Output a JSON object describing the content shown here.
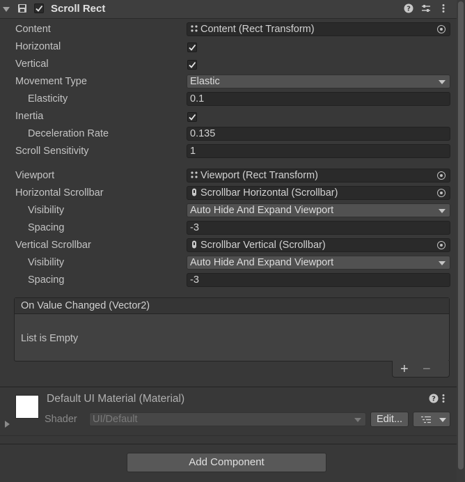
{
  "component": {
    "title": "Scroll Rect",
    "enabled": true
  },
  "properties": {
    "content": {
      "label": "Content",
      "value": "Content (Rect Transform)"
    },
    "horizontal": {
      "label": "Horizontal",
      "checked": true
    },
    "vertical": {
      "label": "Vertical",
      "checked": true
    },
    "movement_type": {
      "label": "Movement Type",
      "value": "Elastic"
    },
    "elasticity": {
      "label": "Elasticity",
      "value": "0.1"
    },
    "inertia": {
      "label": "Inertia",
      "checked": true
    },
    "deceleration_rate": {
      "label": "Deceleration Rate",
      "value": "0.135"
    },
    "scroll_sensitivity": {
      "label": "Scroll Sensitivity",
      "value": "1"
    },
    "viewport": {
      "label": "Viewport",
      "value": "Viewport (Rect Transform)"
    },
    "horizontal_scrollbar": {
      "label": "Horizontal Scrollbar",
      "value": "Scrollbar Horizontal (Scrollbar)"
    },
    "h_visibility": {
      "label": "Visibility",
      "value": "Auto Hide And Expand Viewport"
    },
    "h_spacing": {
      "label": "Spacing",
      "value": "-3"
    },
    "vertical_scrollbar": {
      "label": "Vertical Scrollbar",
      "value": "Scrollbar Vertical (Scrollbar)"
    },
    "v_visibility": {
      "label": "Visibility",
      "value": "Auto Hide And Expand Viewport"
    },
    "v_spacing": {
      "label": "Spacing",
      "value": "-3"
    }
  },
  "event": {
    "title": "On Value Changed (Vector2)",
    "empty_text": "List is Empty",
    "add_label": "+",
    "remove_label": "−"
  },
  "material": {
    "name": "Default UI Material (Material)",
    "shader_label": "Shader",
    "shader_value": "UI/Default",
    "edit_label": "Edit..."
  },
  "footer": {
    "add_component_label": "Add Component"
  },
  "icons": {
    "header_help": "help-icon",
    "header_presets": "presets-icon",
    "header_menu": "kebab-menu-icon",
    "rect_transform": "rect-transform-icon",
    "scrollbar": "scrollbar-icon",
    "object_picker": "object-picker-icon"
  },
  "colors": {
    "panel_bg": "#383838",
    "field_bg": "#2a2a2a",
    "dropdown_bg": "#515151",
    "text": "#c4c4c4"
  }
}
